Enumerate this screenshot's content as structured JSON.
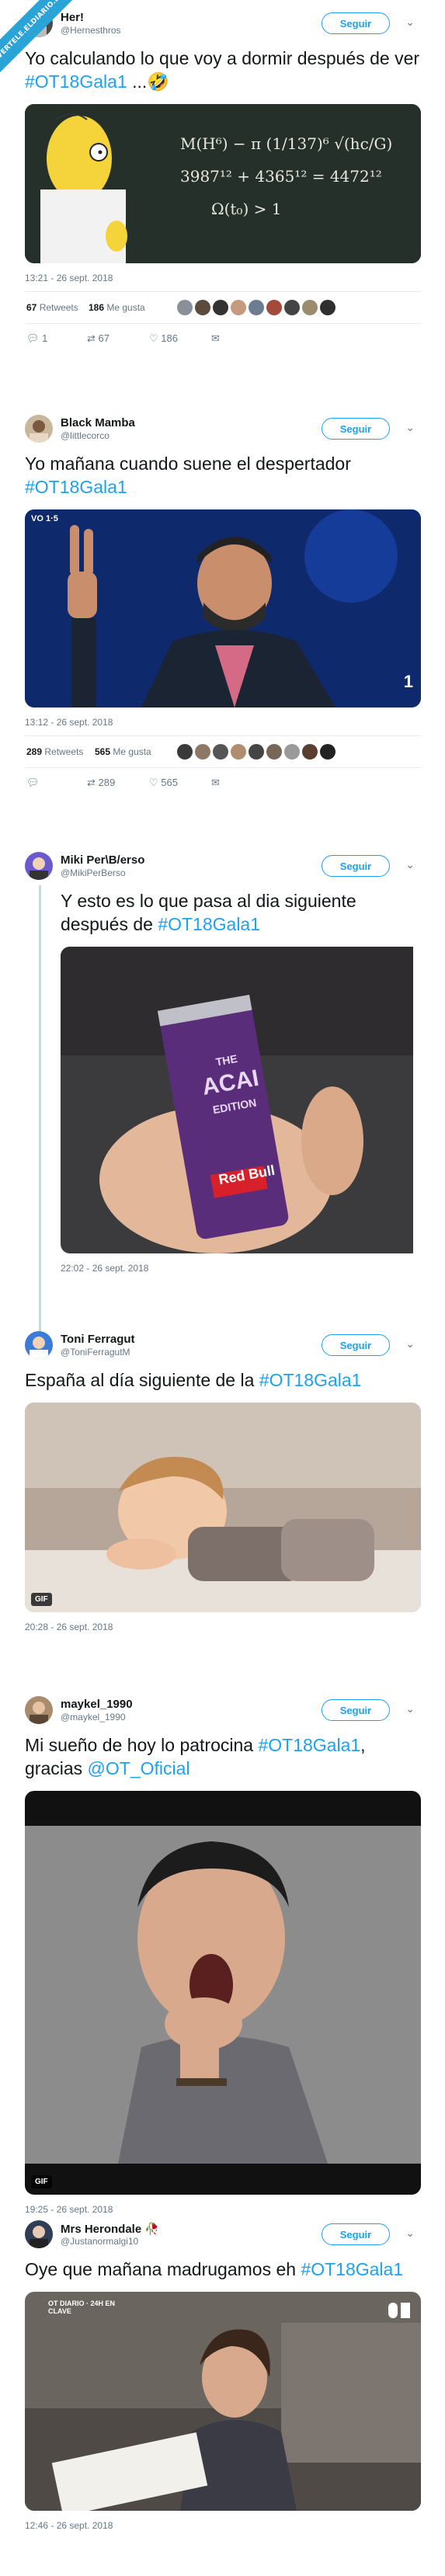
{
  "watermark": "VERTELE.ELDIARIO.ES",
  "follow_label": "Seguir",
  "gif_label": "GIF",
  "tweets": [
    {
      "name": "Her!",
      "handle": "@Hernesthros",
      "text": "Yo calculando lo que voy a dormir después de ver ",
      "hashtag": "#OT18Gala1",
      "text_after": " ...🤣",
      "time": "13:21 - 26 sept. 2018",
      "retweets": "67",
      "retweets_label": "Retweets",
      "likes": "186",
      "likes_label": "Me gusta",
      "reply_count": "1",
      "rt_count": "67",
      "like_count": "186",
      "blackboard_lines": [
        "M(H⁶) − π (1/137)⁶ √(hc/G)",
        "3987¹² + 4365¹² = 4472¹²",
        "Ω(t₀) > 1"
      ]
    },
    {
      "name": "Black Mamba",
      "handle": "@littlecorco",
      "text": "Yo mañana cuando suene el despertador ",
      "hashtag": "#OT18Gala1",
      "time": "13:12 - 26 sept. 2018",
      "retweets": "289",
      "retweets_label": "Retweets",
      "likes": "565",
      "likes_label": "Me gusta",
      "reply_count": "",
      "rt_count": "289",
      "like_count": "565",
      "overlay_left": "VO 1·5",
      "overlay_right": "1"
    },
    {
      "name": "Miki Per\\B/erso",
      "handle": "@MikiPerBerso",
      "text": "Y esto es lo que pasa al dia siguiente después de ",
      "hashtag": "#OT18Gala1",
      "time": "22:02 - 26 sept. 2018",
      "can_lines": [
        "THE",
        "ACAI",
        "EDITION",
        "Red Bull"
      ]
    },
    {
      "name": "Toni Ferragut",
      "handle": "@ToniFerragutM",
      "text": "España al día siguiente de la ",
      "hashtag": "#OT18Gala1",
      "time": "20:28 - 26 sept. 2018"
    },
    {
      "name": "maykel_1990",
      "handle": "@maykel_1990",
      "text": "Mi sueño de hoy lo patrocina ",
      "hashtag": "#OT18Gala1",
      "text_mid": ", gracias ",
      "mention": "@OT_Oficial",
      "time": "19:25 - 26 sept. 2018"
    },
    {
      "name": "Mrs Herondale 🥀",
      "handle": "@Justanormalgi10",
      "text": "Oye que mañana madrugamos eh ",
      "hashtag": "#OT18Gala1",
      "time": "12:46 - 26 sept. 2018",
      "overlay_text": "OT DIARIO · 24H EN CLAVE"
    }
  ],
  "colors": {
    "link": "#1da1f2",
    "muted": "#657786",
    "text": "#14171a"
  }
}
